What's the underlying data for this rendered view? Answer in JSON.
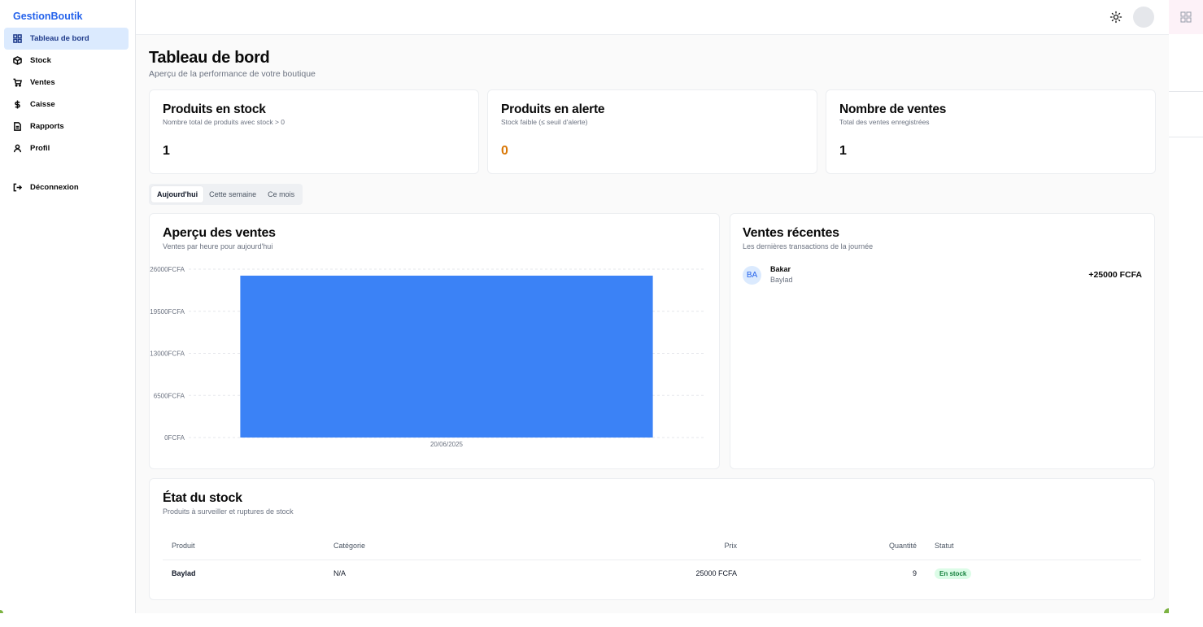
{
  "brand": "GestionBoutik",
  "nav": [
    {
      "label": "Tableau de bord",
      "icon": "dashboard-icon"
    },
    {
      "label": "Stock",
      "icon": "package-icon"
    },
    {
      "label": "Ventes",
      "icon": "cart-icon"
    },
    {
      "label": "Caisse",
      "icon": "dollar-icon"
    },
    {
      "label": "Rapports",
      "icon": "file-icon"
    },
    {
      "label": "Profil",
      "icon": "user-icon"
    }
  ],
  "logout": "Déconnexion",
  "header": {
    "title": "Tableau de bord",
    "subtitle": "Aperçu de la performance de votre boutique"
  },
  "stats": [
    {
      "title": "Produits en stock",
      "desc": "Nombre total de produits avec stock > 0",
      "value": "1"
    },
    {
      "title": "Produits en alerte",
      "desc": "Stock faible (≤ seuil d'alerte)",
      "value": "0"
    },
    {
      "title": "Nombre de ventes",
      "desc": "Total des ventes enregistrées",
      "value": "1"
    }
  ],
  "tabs": [
    "Aujourd'hui",
    "Cette semaine",
    "Ce mois"
  ],
  "chart_card": {
    "title": "Aperçu des ventes",
    "subtitle": "Ventes par heure pour aujourd'hui"
  },
  "chart_data": {
    "type": "bar",
    "categories": [
      "20/06/2025"
    ],
    "values": [
      25000
    ],
    "ylim": [
      0,
      26000
    ],
    "yticks": [
      "26000FCFA",
      "19500FCFA",
      "13000FCFA",
      "6500FCFA",
      "0FCFA"
    ],
    "grid": true,
    "color": "#3b82f6"
  },
  "recent": {
    "title": "Ventes récentes",
    "subtitle": "Les dernières transactions de la journée",
    "items": [
      {
        "initials": "BA",
        "name": "Bakar",
        "product": "Baylad",
        "amount": "+25000 FCFA"
      }
    ]
  },
  "stock": {
    "title": "État du stock",
    "subtitle": "Produits à surveiller et ruptures de stock",
    "columns": [
      "Produit",
      "Catégorie",
      "Prix",
      "Quantité",
      "Statut"
    ],
    "rows": [
      {
        "produit": "Baylad",
        "categorie": "N/A",
        "prix": "25000 FCFA",
        "quantite": "9",
        "statut": "En stock"
      }
    ]
  }
}
